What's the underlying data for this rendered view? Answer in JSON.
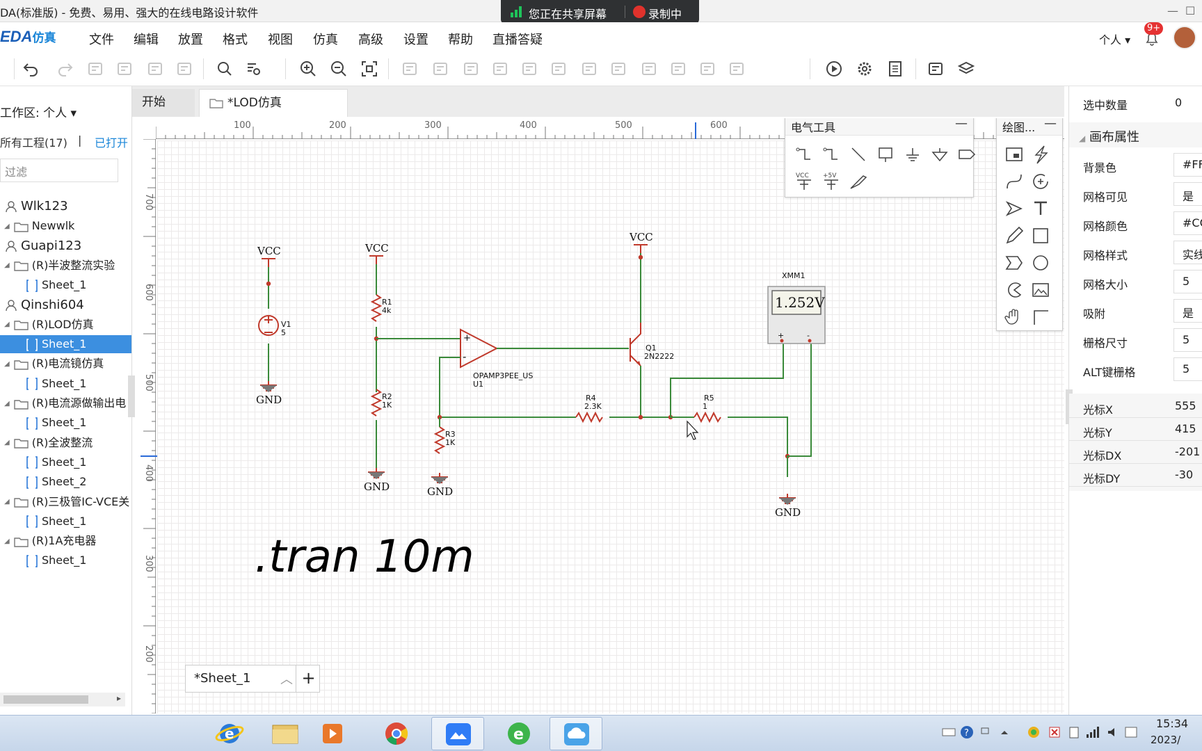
{
  "window": {
    "title": "DA(标准版) - 免费、易用、强大的在线电路设计软件"
  },
  "share_bar": {
    "sharing": "您正在共享屏幕",
    "recording": "录制中",
    "accent": "#1ec45a",
    "rec_color": "#e0322c"
  },
  "app": {
    "logo": "EDA",
    "logo_suffix": "仿真",
    "brand_color": "#1b5fb8"
  },
  "menu": [
    "文件",
    "编辑",
    "放置",
    "格式",
    "视图",
    "仿真",
    "高级",
    "设置",
    "帮助",
    "直播答疑"
  ],
  "user": {
    "label": "个人",
    "badge": "9+"
  },
  "toolbar": [
    "undo-icon",
    "redo-icon",
    "copy-icon",
    "paste-icon",
    "cut-icon",
    "delete-icon",
    "search-icon",
    "find-replace-icon",
    "zoom-in-icon",
    "zoom-out-icon",
    "fit-icon",
    "align-left-icon",
    "align-right-icon",
    "align-top-icon",
    "align-bottom-icon",
    "align-center-h-icon",
    "align-center-v-icon",
    "distribute-h-icon",
    "distribute-v-icon",
    "group-icon",
    "ungroup-icon",
    "bring-front-icon",
    "send-back-icon",
    "run-icon",
    "settings-icon",
    "netlist-icon",
    "image-icon",
    "layers-icon"
  ],
  "sidebar": {
    "workspace": "工作区: 个人",
    "all_projects": "所有工程(17)",
    "sep": "|",
    "open_projects": "已打开",
    "filter_placeholder": "过滤",
    "tree": [
      {
        "type": "user",
        "label": "Wlk123"
      },
      {
        "type": "folder",
        "label": "Newwlk"
      },
      {
        "type": "user",
        "label": "Guapi123"
      },
      {
        "type": "folder",
        "label": "(R)半波整流实验"
      },
      {
        "type": "sheet",
        "label": "Sheet_1"
      },
      {
        "type": "user",
        "label": "Qinshi604"
      },
      {
        "type": "folder",
        "label": "(R)LOD仿真"
      },
      {
        "type": "sheet",
        "label": "Sheet_1",
        "selected": true
      },
      {
        "type": "folder",
        "label": "(R)电流镜仿真"
      },
      {
        "type": "sheet",
        "label": "Sheet_1"
      },
      {
        "type": "folder",
        "label": "(R)电流源做输出电"
      },
      {
        "type": "sheet",
        "label": "Sheet_1"
      },
      {
        "type": "folder",
        "label": "(R)全波整流"
      },
      {
        "type": "sheet",
        "label": "Sheet_1"
      },
      {
        "type": "sheet",
        "label": "Sheet_2"
      },
      {
        "type": "folder",
        "label": "(R)三极管IC-VCE关"
      },
      {
        "type": "sheet",
        "label": "Sheet_1"
      },
      {
        "type": "folder",
        "label": "(R)1A充电器"
      },
      {
        "type": "sheet",
        "label": "Sheet_1"
      }
    ]
  },
  "tabs": [
    {
      "label": "开始"
    },
    {
      "label": "*LOD仿真",
      "active": true
    }
  ],
  "ruler": {
    "top": [
      "100",
      "200",
      "300",
      "400",
      "500",
      "600"
    ],
    "left": [
      "700",
      "600",
      "500",
      "400",
      "300",
      "200"
    ]
  },
  "schematic": {
    "labels": {
      "vcc": "VCC",
      "gnd": "GND",
      "v1": "V1",
      "v1_val": "5",
      "r1": "R1",
      "r1_val": "4k",
      "r2": "R2",
      "r2_val": "1K",
      "r3": "R3",
      "r3_val": "1K",
      "r4": "R4",
      "r4_val": "2.3K",
      "r5": "R5",
      "r5_val": "1",
      "q1": "Q1",
      "q1_val": "2N2222",
      "u1_part": "OPAMP3PEE_US",
      "u1": "U1",
      "meter": "XMM1",
      "meter_reading": "1.252V",
      "plus": "+",
      "minus": "-",
      "meter_plus": "+",
      "meter_minus": "-"
    },
    "directive": ".tran 10m",
    "wire_color": "#3a8a3a",
    "part_color": "#c0392b"
  },
  "sheetbar": {
    "label": "*Sheet_1",
    "add": "+"
  },
  "elec_tools": {
    "title": "电气工具",
    "min": "—",
    "vcc": "VCC",
    "v5": "+5V"
  },
  "draw_tools": {
    "title": "绘图...",
    "min": "—"
  },
  "props": {
    "selected_label": "选中数量",
    "selected_count": "0",
    "section": "画布属性",
    "rows": [
      {
        "k": "背景色",
        "v": "#FFFFFF"
      },
      {
        "k": "网格可见",
        "v": "是"
      },
      {
        "k": "网格颜色",
        "v": "#CCCCCC"
      },
      {
        "k": "网格样式",
        "v": "实线"
      },
      {
        "k": "网格大小",
        "v": "5"
      },
      {
        "k": "吸附",
        "v": "是"
      },
      {
        "k": "栅格尺寸",
        "v": "5"
      },
      {
        "k": "ALT键栅格",
        "v": "5"
      }
    ],
    "coords": [
      {
        "k": "光标X",
        "v": "555"
      },
      {
        "k": "光标Y",
        "v": "415"
      },
      {
        "k": "光标DX",
        "v": "-201"
      },
      {
        "k": "光标DY",
        "v": "-30"
      }
    ]
  },
  "taskbar": {
    "time": "15:34",
    "date": "2023/"
  }
}
